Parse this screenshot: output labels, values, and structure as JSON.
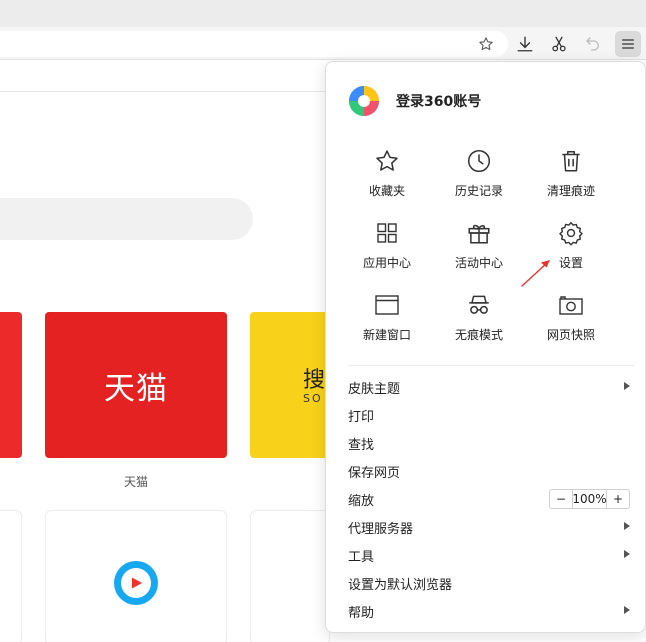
{
  "browser": {
    "toolbar_icons": [
      "star-icon",
      "download-icon",
      "scissors-icon",
      "undo-icon",
      "menu-icon"
    ]
  },
  "page": {
    "tiles": [
      {
        "name": "tmall",
        "logo_text": "天猫",
        "label": "天猫",
        "color": "#e52222"
      },
      {
        "name": "sogou",
        "logo_text": "搜",
        "sub_text": "SO",
        "color": "#f7d11a"
      }
    ],
    "cards": [
      {
        "icon": "video-play-icon",
        "color": "#17a8f2"
      }
    ]
  },
  "menu": {
    "login_label": "登录360账号",
    "grid": [
      {
        "icon": "star-outline-icon",
        "label": "收藏夹"
      },
      {
        "icon": "clock-icon",
        "label": "历史记录"
      },
      {
        "icon": "trash-icon",
        "label": "清理痕迹"
      },
      {
        "icon": "apps-grid-icon",
        "label": "应用中心"
      },
      {
        "icon": "gift-icon",
        "label": "活动中心"
      },
      {
        "icon": "gear-icon",
        "label": "设置"
      },
      {
        "icon": "new-window-icon",
        "label": "新建窗口"
      },
      {
        "icon": "incognito-icon",
        "label": "无痕模式"
      },
      {
        "icon": "camera-icon",
        "label": "网页快照"
      }
    ],
    "items": [
      {
        "label": "皮肤主题",
        "submenu": true
      },
      {
        "label": "打印",
        "submenu": false
      },
      {
        "label": "查找",
        "submenu": false
      },
      {
        "label": "保存网页",
        "submenu": false
      },
      {
        "label": "缩放",
        "submenu": false,
        "zoom": {
          "minus": "−",
          "value": "100%",
          "plus": "+"
        }
      },
      {
        "label": "代理服务器",
        "submenu": true
      },
      {
        "label": "工具",
        "submenu": true
      },
      {
        "label": "设置为默认浏览器",
        "submenu": false
      },
      {
        "label": "帮助",
        "submenu": true
      }
    ]
  },
  "annotation": {
    "color": "#e8332a"
  }
}
